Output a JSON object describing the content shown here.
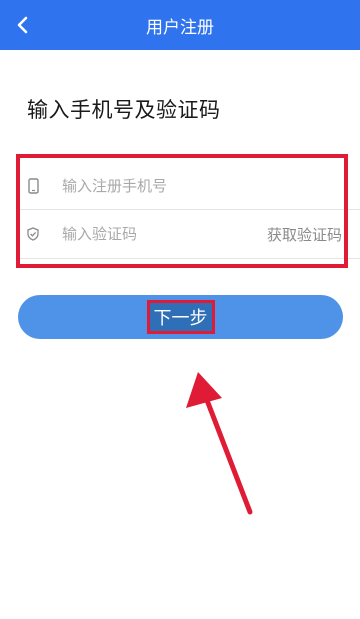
{
  "header": {
    "title": "用户注册",
    "back_icon": "chevron-left-icon",
    "background_color": "#2f73ee"
  },
  "page": {
    "heading": "输入手机号及验证码"
  },
  "form": {
    "phone": {
      "icon": "phone-icon",
      "placeholder": "输入注册手机号"
    },
    "code": {
      "icon": "shield-check-icon",
      "placeholder": "输入验证码",
      "get_code_label": "获取验证码"
    }
  },
  "next_button": {
    "label": "下一步",
    "color": "#4f93e8"
  },
  "annotations": {
    "highlight_color": "#e01b35"
  }
}
